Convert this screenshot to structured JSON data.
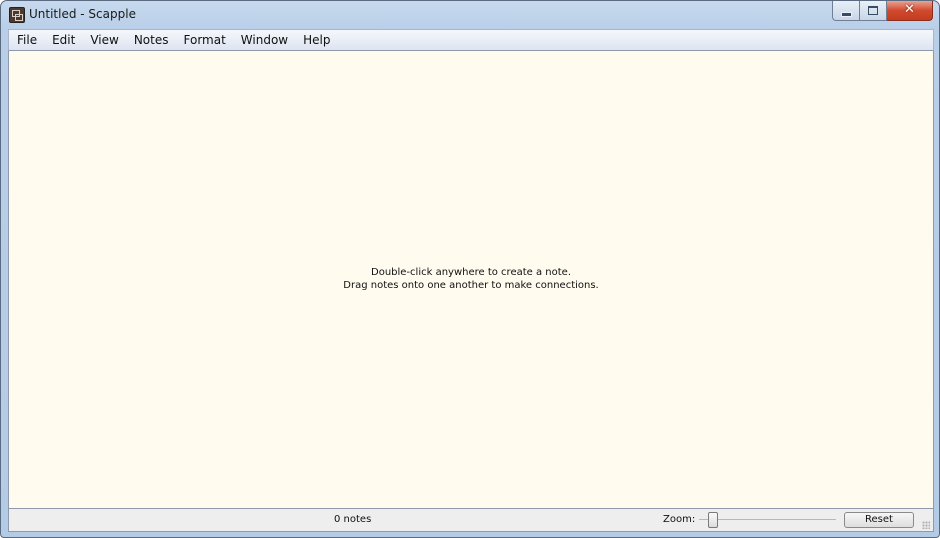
{
  "window": {
    "title": "Untitled - Scapple",
    "app_icon": "scapple-app-icon",
    "controls": {
      "minimize": "minimize-icon",
      "maximize": "maximize-icon",
      "close": "close-icon",
      "close_glyph": "✕"
    }
  },
  "menubar": {
    "items": [
      {
        "label": "File"
      },
      {
        "label": "Edit"
      },
      {
        "label": "View"
      },
      {
        "label": "Notes"
      },
      {
        "label": "Format"
      },
      {
        "label": "Window"
      },
      {
        "label": "Help"
      }
    ]
  },
  "canvas": {
    "hint_line1": "Double-click anywhere to create a note.",
    "hint_line2": "Drag notes onto one another to make connections.",
    "background_color": "#fffbef"
  },
  "statusbar": {
    "notes_count": "0 notes",
    "zoom_label": "Zoom:",
    "zoom_slider_position": 0.1,
    "reset_label": "Reset"
  }
}
